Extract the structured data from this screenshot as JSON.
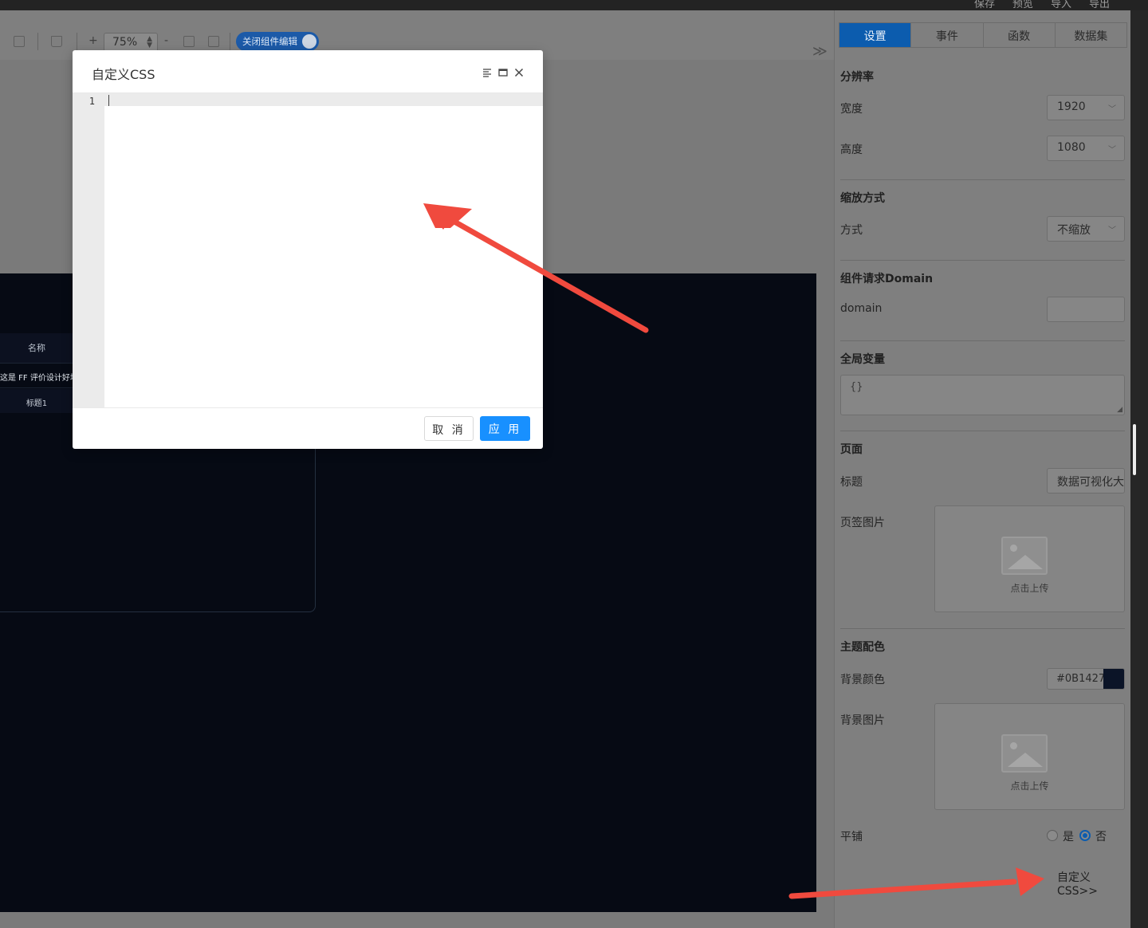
{
  "topbar": {
    "actions": [
      "保存",
      "预览",
      "导入",
      "导出"
    ]
  },
  "toolbar": {
    "zoom_in": "+",
    "zoom_value": "75%",
    "zoom_out": "-",
    "toggle_label": "关闭组件编辑",
    "collapse": "≫"
  },
  "canvas": {
    "table_header": "名称",
    "row1": "这是 FF 评价设计好坏",
    "row2": "标题1",
    "background": "#060A14"
  },
  "modal": {
    "title": "自定义CSS",
    "line_number": "1",
    "cancel_label": "取 消",
    "apply_label": "应 用"
  },
  "panel": {
    "tabs": [
      {
        "label": "设置",
        "active": true
      },
      {
        "label": "事件",
        "active": false
      },
      {
        "label": "函数",
        "active": false
      },
      {
        "label": "数据集",
        "active": false
      }
    ],
    "resolution": {
      "title": "分辨率",
      "width_label": "宽度",
      "width_value": "1920",
      "height_label": "高度",
      "height_value": "1080"
    },
    "scale": {
      "title": "缩放方式",
      "mode_label": "方式",
      "mode_value": "不缩放"
    },
    "domain": {
      "title": "组件请求Domain",
      "label": "domain",
      "value": ""
    },
    "globals": {
      "title": "全局变量",
      "value": "{}"
    },
    "page": {
      "title": "页面",
      "title_label": "标题",
      "title_value": "数据可视化大屏",
      "favicon_label": "页签图片",
      "upload_text": "点击上传"
    },
    "theme": {
      "title": "主题配色",
      "bg_color_label": "背景颜色",
      "bg_color_value": "#0B1427",
      "bg_image_label": "背景图片",
      "upload_text": "点击上传",
      "tile_label": "平铺",
      "tile_yes": "是",
      "tile_no": "否",
      "tile_selected": "否"
    },
    "custom_css_link": "自定义CSS>>"
  },
  "colors": {
    "accent": "#1890FF",
    "tab_active": "#0C5CAE",
    "arrow": "#F04A3E"
  }
}
